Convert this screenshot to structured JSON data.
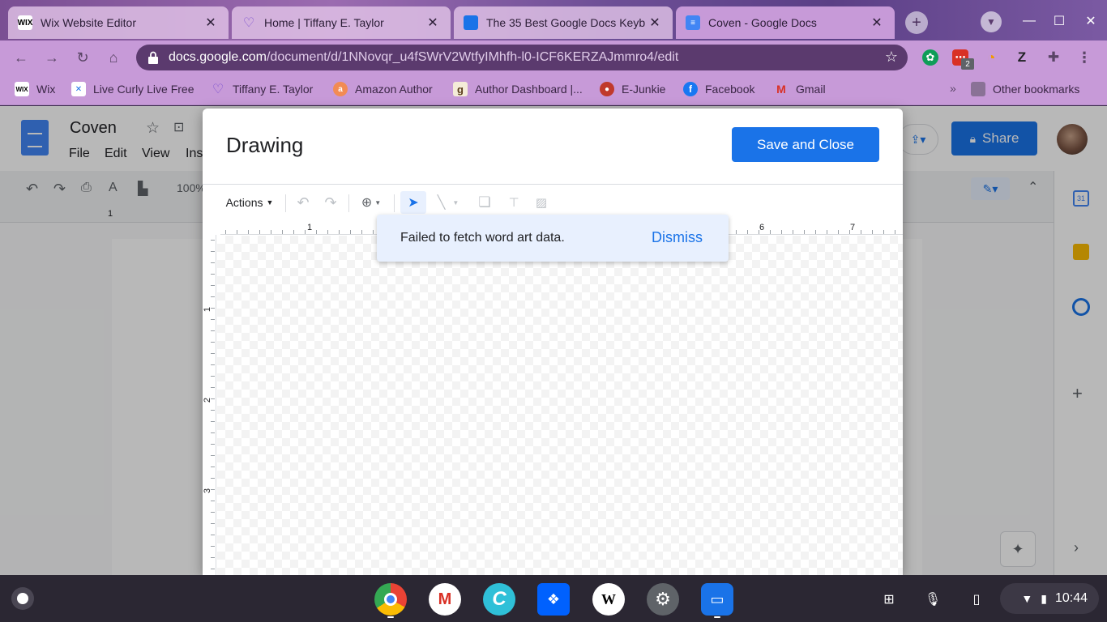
{
  "tabs": [
    {
      "title": "Wix Website Editor",
      "icon": "wix-icon",
      "active": false
    },
    {
      "title": "Home | Tiffany E. Taylor",
      "icon": "heart-icon",
      "active": false
    },
    {
      "title": "The 35 Best Google Docs Keyb",
      "icon": "site-icon",
      "active": false
    },
    {
      "title": "Coven - Google Docs",
      "icon": "docs-icon",
      "active": true
    }
  ],
  "omnibox": {
    "host": "docs.google.com",
    "path": "/document/d/1NNovqr_u4fSWrV2WtfyIMhfh-l0-ICF6KERZAJmmro4/edit"
  },
  "extensions": {
    "badge_count": "2",
    "z_label": "Z"
  },
  "bookmarks": [
    {
      "label": "Wix",
      "icon": "wix-icon"
    },
    {
      "label": "Live Curly Live Free",
      "icon": "bookmark-icon"
    },
    {
      "label": "Tiffany E. Taylor",
      "icon": "heart-icon"
    },
    {
      "label": "Amazon Author",
      "icon": "amazon-icon"
    },
    {
      "label": "Author Dashboard |...",
      "icon": "goodreads-icon"
    },
    {
      "label": "E-Junkie",
      "icon": "ejunkie-icon"
    },
    {
      "label": "Facebook",
      "icon": "facebook-icon"
    },
    {
      "label": "Gmail",
      "icon": "gmail-icon"
    }
  ],
  "bookmarks_more": "»",
  "other_bookmarks": "Other bookmarks",
  "docs": {
    "title": "Coven",
    "menu": [
      "File",
      "Edit",
      "View",
      "Ins"
    ],
    "zoom": "100%",
    "share_label": "Share"
  },
  "dialog": {
    "title": "Drawing",
    "save_label": "Save and Close",
    "actions_label": "Actions",
    "toast_message": "Failed to fetch word art data.",
    "toast_action": "Dismiss",
    "hruler_numbers": [
      "1",
      "6",
      "7"
    ],
    "vruler_numbers": [
      "1",
      "2",
      "3"
    ]
  },
  "docs_ruler": {
    "left_numbers": [
      "1"
    ]
  },
  "shelf": {
    "time": "10:44"
  },
  "colors": {
    "accent": "#1a73e8",
    "toast_bg": "#e8f0fe",
    "chrome_frame": "#c79ad8"
  }
}
